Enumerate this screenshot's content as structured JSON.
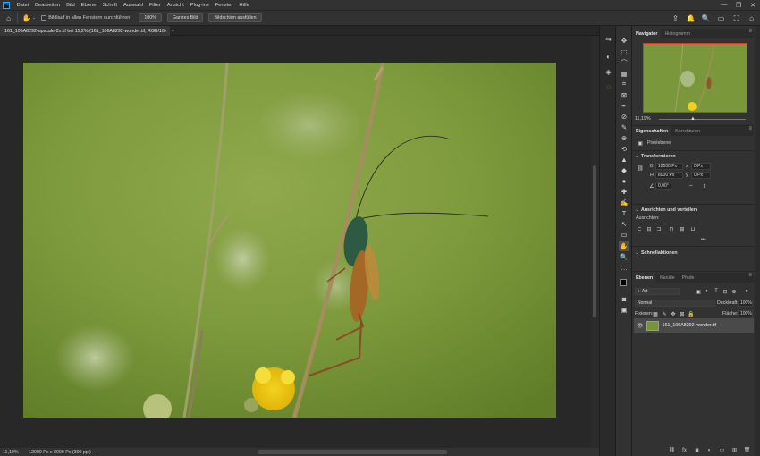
{
  "menubar": {
    "logo": "Ps",
    "items": [
      "Datei",
      "Bearbeiten",
      "Bild",
      "Ebene",
      "Schrift",
      "Auswahl",
      "Filter",
      "Ansicht",
      "Plug-ins",
      "Fenster",
      "Hilfe"
    ],
    "window_controls": [
      "—",
      "❐",
      "✕"
    ]
  },
  "options": {
    "home_icon": "⌂",
    "hand_icon": "✋",
    "scroll_all_label": "Bildlauf in allen Fenstern durchführen",
    "zoom_btn": "100%",
    "fit_btn": "Ganzes Bild",
    "fill_btn": "Bildschirm ausfüllen",
    "right_icons": [
      "⇪",
      "🔔",
      "🔍",
      "▭",
      "⛶",
      "⌂"
    ]
  },
  "document": {
    "tab_title": "161_106A8292-upscale-2x.tif bei 11,2% (161_106A8292-wonder.tif, RGB/16)",
    "close": "×"
  },
  "status": {
    "zoom": "11,19%",
    "info": "12000 Px x 8000 Px (300 ppi)",
    "arrow": "›"
  },
  "toolbar": {
    "tools": [
      "✥",
      "⬚",
      "⌒",
      "▦",
      "⌗",
      "⊠",
      "✒",
      "⊘",
      "✎",
      "⊕",
      "⟲",
      "▲",
      "◆",
      "●",
      "✚",
      "✍",
      "T",
      "↖",
      "▭",
      "✋",
      "🔍",
      "…"
    ]
  },
  "navigator": {
    "tabs": [
      "Navigator",
      "Histogramm"
    ],
    "zoom": "11,19%"
  },
  "properties": {
    "tabs": [
      "Eigenschaften",
      "Korrekturen"
    ],
    "layer_type": "Pixelebene",
    "transform_title": "Transformieren",
    "w_label": "B",
    "w_value": "12000 Px",
    "h_label": "H",
    "h_value": "8000 Px",
    "x_label": "x",
    "x_value": "0 Px",
    "y_label": "y",
    "y_value": "0 Px",
    "angle_value": "0,00°",
    "align_title": "Ausrichten und verteilen",
    "align_label": "Ausrichten:",
    "more": "•••",
    "quick_title": "Schnellaktionen"
  },
  "layers": {
    "tabs": [
      "Ebenen",
      "Kanäle",
      "Pfade"
    ],
    "filter_label": "Art",
    "blend_mode": "Normal",
    "opacity_label": "Deckkraft:",
    "opacity_value": "100%",
    "lock_label": "Fixieren:",
    "fill_label": "Fläche:",
    "fill_value": "100%",
    "layer_name": "161_106A8292-wonder.tif"
  }
}
